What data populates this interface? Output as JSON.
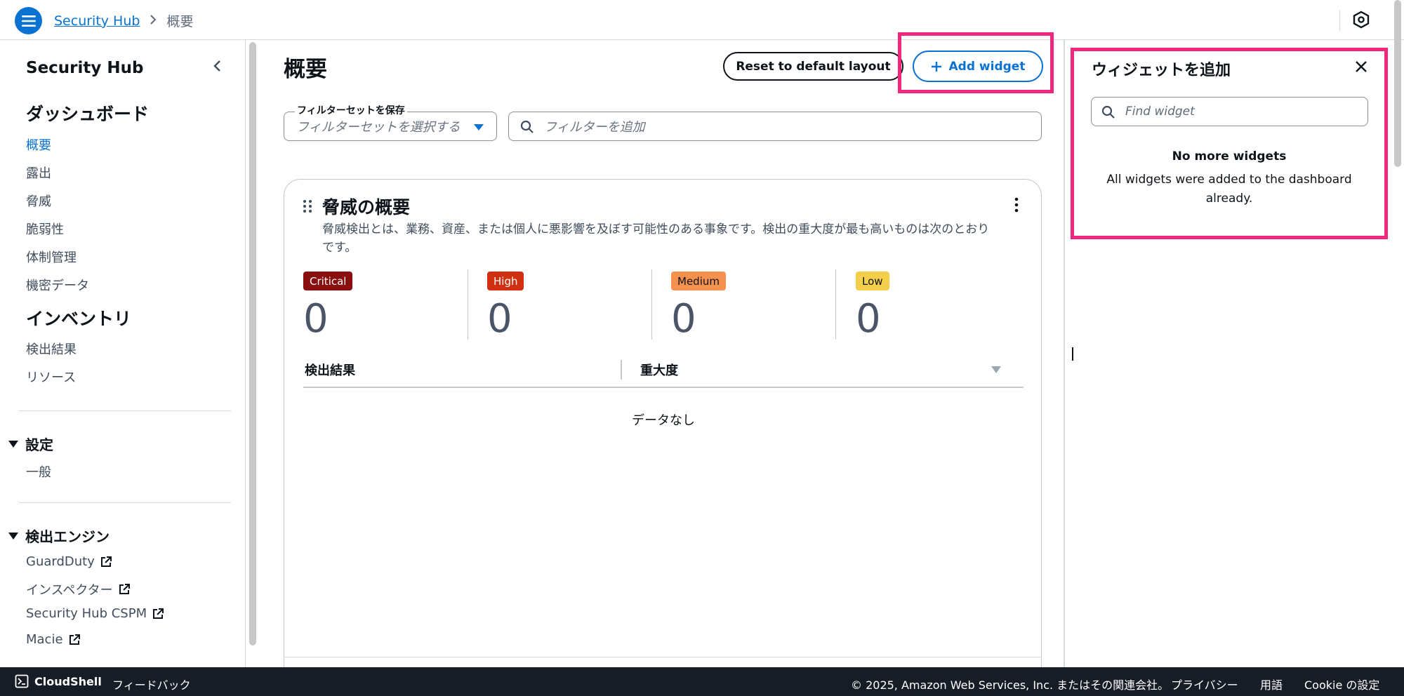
{
  "topbar": {
    "breadcrumb": [
      "Security Hub",
      "概要"
    ]
  },
  "sidebar": {
    "title": "Security Hub",
    "dashboard_heading": "ダッシュボード",
    "dashboard_items": [
      "概要",
      "露出",
      "脅威",
      "脆弱性",
      "体制管理",
      "機密データ"
    ],
    "inventory_heading": "インベントリ",
    "inventory_items": [
      "検出結果",
      "リソース"
    ],
    "settings_section": "設定",
    "settings_items": [
      "一般"
    ],
    "engines_section": "検出エンジン",
    "engine_items": [
      "GuardDuty",
      "インスペクター",
      "Security Hub CSPM",
      "Macie"
    ]
  },
  "main": {
    "title": "概要",
    "reset_button": "Reset to default layout",
    "add_widget_button": "Add widget",
    "filterset_label": "フィルターセットを保存",
    "filterset_placeholder": "フィルターセットを選択する",
    "filter_placeholder": "フィルターを追加"
  },
  "widget": {
    "title": "脅威の概要",
    "description": "脅威検出とは、業務、資産、または個人に悪影響を及ぼす可能性のある事象です。検出の重大度が最も高いものは次のとおりです。",
    "severities": [
      {
        "label": "Critical",
        "count": "0",
        "bg": "#8b0e0e",
        "fg": "#ffffff"
      },
      {
        "label": "High",
        "count": "0",
        "bg": "#d0300f",
        "fg": "#ffffff"
      },
      {
        "label": "Medium",
        "count": "0",
        "bg": "#f5914e",
        "fg": "#0f141a"
      },
      {
        "label": "Low",
        "count": "0",
        "bg": "#f5ce4a",
        "fg": "#0f141a"
      }
    ],
    "col_findings": "検出結果",
    "col_severity": "重大度",
    "empty_text": "データなし"
  },
  "panel": {
    "title": "ウィジェットを追加",
    "search_placeholder": "Find widget",
    "empty_title": "No more widgets",
    "empty_desc": "All widgets were added to the dashboard already."
  },
  "footer": {
    "cloudshell": "CloudShell",
    "feedback": "フィードバック",
    "copyright": "© 2025, Amazon Web Services, Inc. またはその関連会社。",
    "privacy": "プライバシー",
    "terms": "用語",
    "cookie": "Cookie の設定"
  },
  "colors": {
    "accent": "#0972d3",
    "highlight": "#f0287c",
    "footer_bg": "#161d26"
  }
}
